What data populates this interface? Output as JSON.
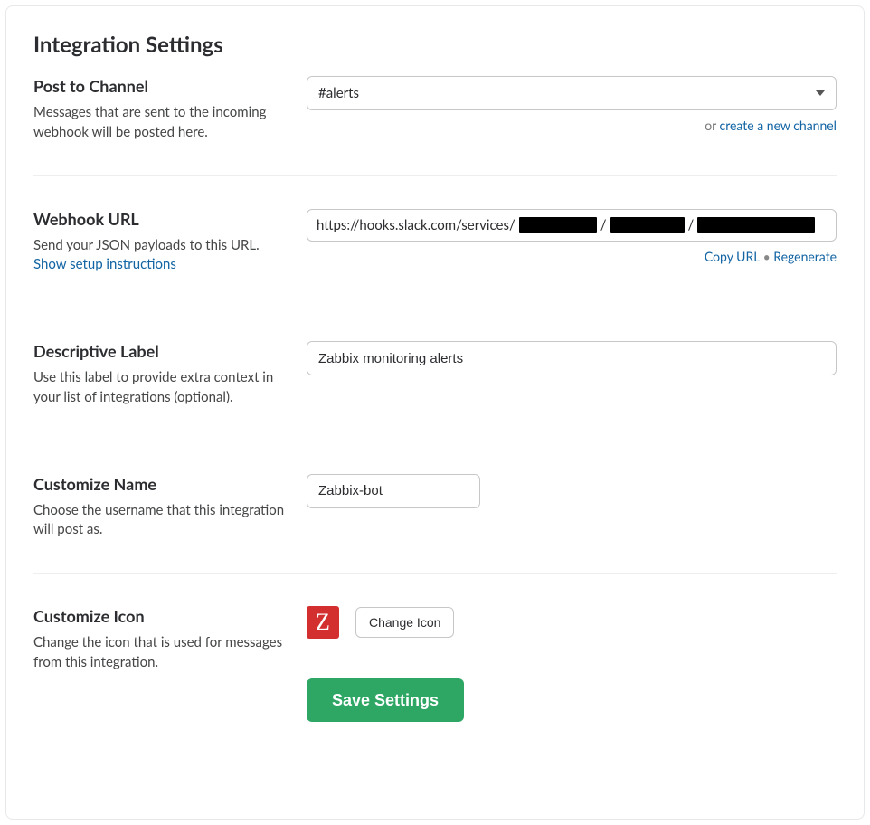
{
  "page_title": "Integration Settings",
  "post_to_channel": {
    "title": "Post to Channel",
    "desc": "Messages that are sent to the incoming webhook will be posted here.",
    "selected": "#alerts",
    "or_text": "or ",
    "create_link": "create a new channel"
  },
  "webhook": {
    "title": "Webhook URL",
    "desc": "Send your JSON payloads to this URL.",
    "setup_link": "Show setup instructions",
    "url_prefix": "https://hooks.slack.com/services/",
    "copy_label": "Copy URL",
    "separator": " • ",
    "regenerate_label": "Regenerate"
  },
  "label": {
    "title": "Descriptive Label",
    "desc": "Use this label to provide extra context in your list of integrations (optional).",
    "value": "Zabbix monitoring alerts"
  },
  "customize_name": {
    "title": "Customize Name",
    "desc": "Choose the username that this integration will post as.",
    "value": "Zabbix-bot"
  },
  "customize_icon": {
    "title": "Customize Icon",
    "desc": "Change the icon that is used for messages from this integration.",
    "letter": "Z",
    "change_button": "Change Icon"
  },
  "save_button": "Save Settings"
}
